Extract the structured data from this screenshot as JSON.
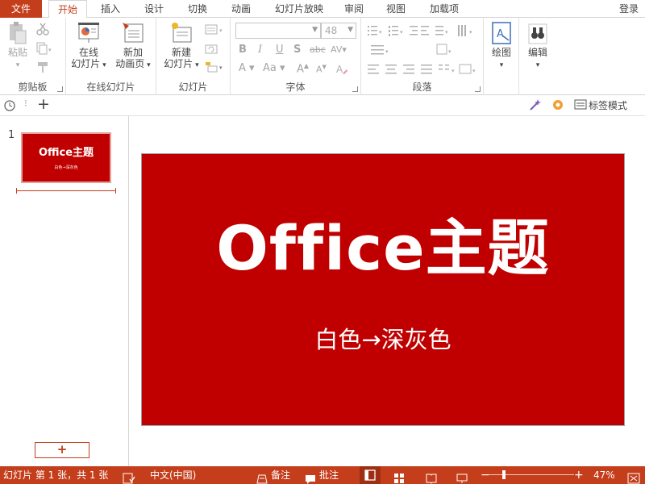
{
  "tabs": {
    "file": "文件",
    "home": "开始",
    "insert": "插入",
    "design": "设计",
    "transitions": "切换",
    "animations": "动画",
    "slideshow": "幻灯片放映",
    "review": "审阅",
    "view": "视图",
    "addins": "加载项"
  },
  "login": "登录",
  "ribbon": {
    "clipboard": {
      "label": "剪贴板",
      "paste_line1": "粘贴"
    },
    "online_slides": {
      "label": "在线幻灯片",
      "online_line1": "在线",
      "online_line2": "幻灯片",
      "new_anim_line1": "新加",
      "new_anim_line2": "动画页"
    },
    "slides": {
      "label": "幻灯片",
      "new_line1": "新建",
      "new_line2": "幻灯片"
    },
    "font": {
      "label": "字体",
      "font_name": "",
      "font_size": "48"
    },
    "paragraph": {
      "label": "段落"
    },
    "drawing": {
      "label": "绘图"
    },
    "editing": {
      "label": "编辑"
    }
  },
  "qbar": {
    "tag_mode": "标签模式"
  },
  "thumbnails": [
    {
      "number": "1",
      "title": "Office主题",
      "subtitle": "白色→深灰色"
    }
  ],
  "add_slide": "+",
  "slide": {
    "title": "Office主题",
    "subtitle": "白色→深灰色"
  },
  "status": {
    "slide_info": "幻灯片 第 1 张，共 1 张",
    "language": "中文(中国)",
    "notes": "备注",
    "comments": "批注",
    "zoom_minus": "−",
    "zoom_plus": "+",
    "zoom": "47%",
    "zoom_level_percent": 47
  },
  "colors": {
    "accent": "#c43e1c",
    "slide_bg": "#c00000"
  }
}
